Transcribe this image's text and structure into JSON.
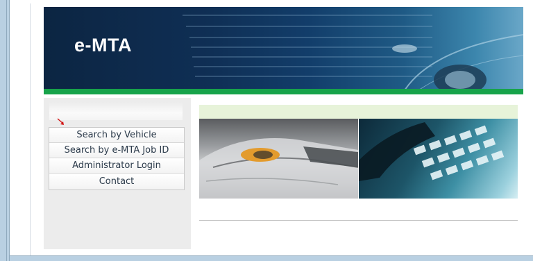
{
  "brand": {
    "logo_text": "e-MTA"
  },
  "colors": {
    "header_dark": "#0c2542",
    "accent_green": "#17a34a",
    "sidebar_bg": "#ececec",
    "banner_strip": "#e7f3d9",
    "frame_blue": "#b9d0e2"
  },
  "sidebar": {
    "items": [
      {
        "label": "Search by Vehicle"
      },
      {
        "label": "Search by e-MTA Job ID"
      },
      {
        "label": "Administrator Login"
      },
      {
        "label": "Contact"
      }
    ]
  },
  "icons": {
    "pointer": "red-arrow-icon"
  }
}
